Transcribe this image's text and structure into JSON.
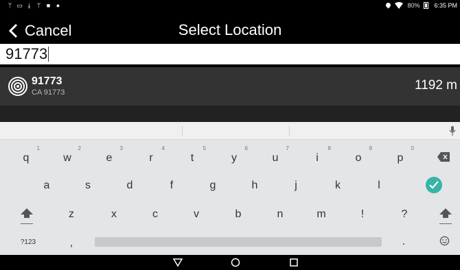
{
  "status_bar": {
    "battery": "80%",
    "time": "6:35 PM",
    "left_icons": [
      "usb-icon",
      "image-icon",
      "download-icon",
      "usb-icon",
      "shopping-bag-icon",
      "android-icon"
    ]
  },
  "header": {
    "back_label": "Cancel",
    "title": "Select Location"
  },
  "search": {
    "value": "91773"
  },
  "results": [
    {
      "name": "91773",
      "subtitle": "CA 91773",
      "distance": "1192 m"
    }
  ],
  "keyboard": {
    "row1": [
      {
        "label": "q",
        "hint": "1"
      },
      {
        "label": "w",
        "hint": "2"
      },
      {
        "label": "e",
        "hint": "3"
      },
      {
        "label": "r",
        "hint": "4"
      },
      {
        "label": "t",
        "hint": "5"
      },
      {
        "label": "y",
        "hint": "6"
      },
      {
        "label": "u",
        "hint": "7"
      },
      {
        "label": "i",
        "hint": "8"
      },
      {
        "label": "o",
        "hint": "9"
      },
      {
        "label": "p",
        "hint": "0"
      }
    ],
    "row2": [
      "a",
      "s",
      "d",
      "f",
      "g",
      "h",
      "j",
      "k",
      "l"
    ],
    "row3": [
      "z",
      "x",
      "c",
      "v",
      "b",
      "n",
      "m",
      "!",
      "?"
    ],
    "symbols_label": "?123",
    "comma": ",",
    "period": "."
  },
  "colors": {
    "accent": "#36b4a7",
    "result_bg": "#333333",
    "keyboard_bg": "#e4e5e7"
  }
}
